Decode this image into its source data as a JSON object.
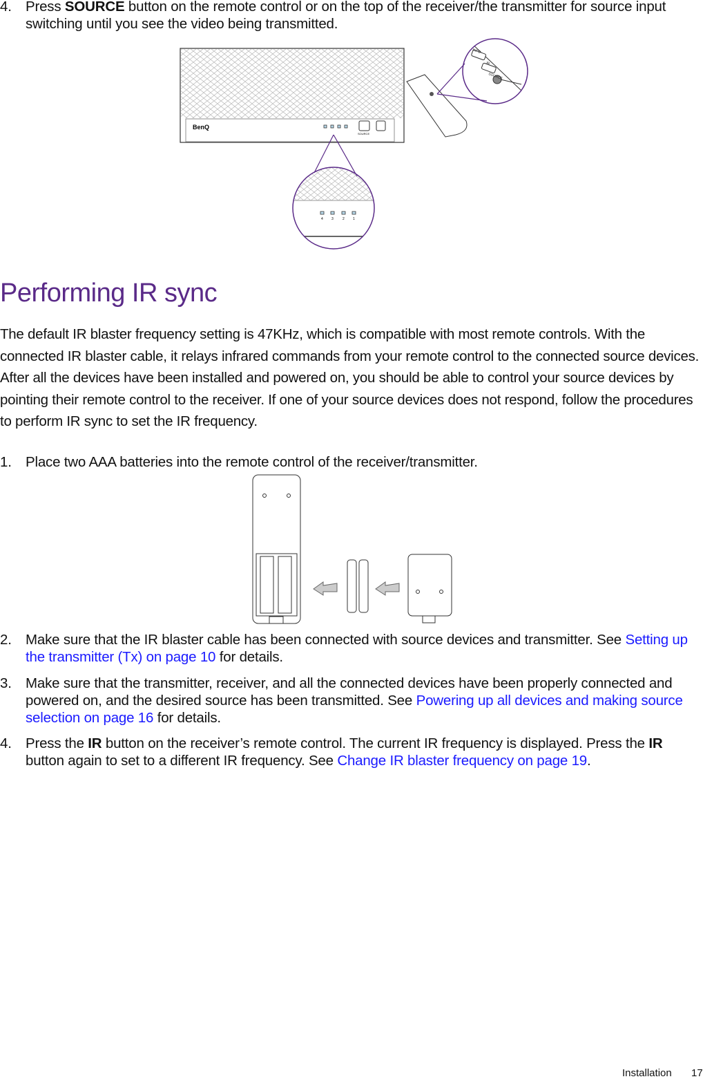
{
  "step_source": {
    "number": "4.",
    "pre": "Press ",
    "bold": "SOURCE",
    "post": " button on the remote control or on the top of the receiver/the transmitter for source input switching until you see the video being transmitted."
  },
  "figure1": {
    "logo": "BenQ",
    "source_label": "SOURCE",
    "leds": [
      "4",
      "3",
      "2",
      "1"
    ],
    "remote_buttons": [
      "INFO",
      "IR",
      "SOURCE"
    ],
    "accent": "#5a2a88"
  },
  "section": {
    "title": "Performing IR sync",
    "intro": "The default IR blaster frequency setting is 47KHz, which is compatible with most remote controls. With the connected IR blaster cable, it relays infrared commands from your remote control to the connected source devices. After all the devices have been installed and powered on, you should be able to control your source devices by pointing their remote control to the receiver. If one of your source devices does not respond, follow the procedures to perform IR sync to set the IR frequency."
  },
  "steps": [
    {
      "number": "1.",
      "text": "Place two AAA batteries into the remote control of the receiver/transmitter."
    },
    {
      "number": "2.",
      "pre": "Make sure that the IR blaster cable has been connected with source devices and transmitter. See ",
      "link": "Setting up the transmitter (Tx) on page 10",
      "post": " for details."
    },
    {
      "number": "3.",
      "pre": "Make sure that the transmitter, receiver, and all the connected devices have been properly connected and powered on, and the desired source has been transmitted. See ",
      "link": "Powering up all devices and making source selection on page 16",
      "post": " for details."
    },
    {
      "number": "4.",
      "pre1": "Press the ",
      "bold1": "IR",
      "mid": " button on the receiver’s remote control. The current IR frequency is displayed. Press the ",
      "bold2": "IR",
      "pre2": " button again to set to a different IR frequency. See ",
      "link": "Change IR blaster frequency on page 19",
      "post": "."
    }
  ],
  "colors": {
    "heading": "#5a2a88",
    "link": "#1a1aff"
  },
  "footer": {
    "section": "Installation",
    "page": "17"
  }
}
